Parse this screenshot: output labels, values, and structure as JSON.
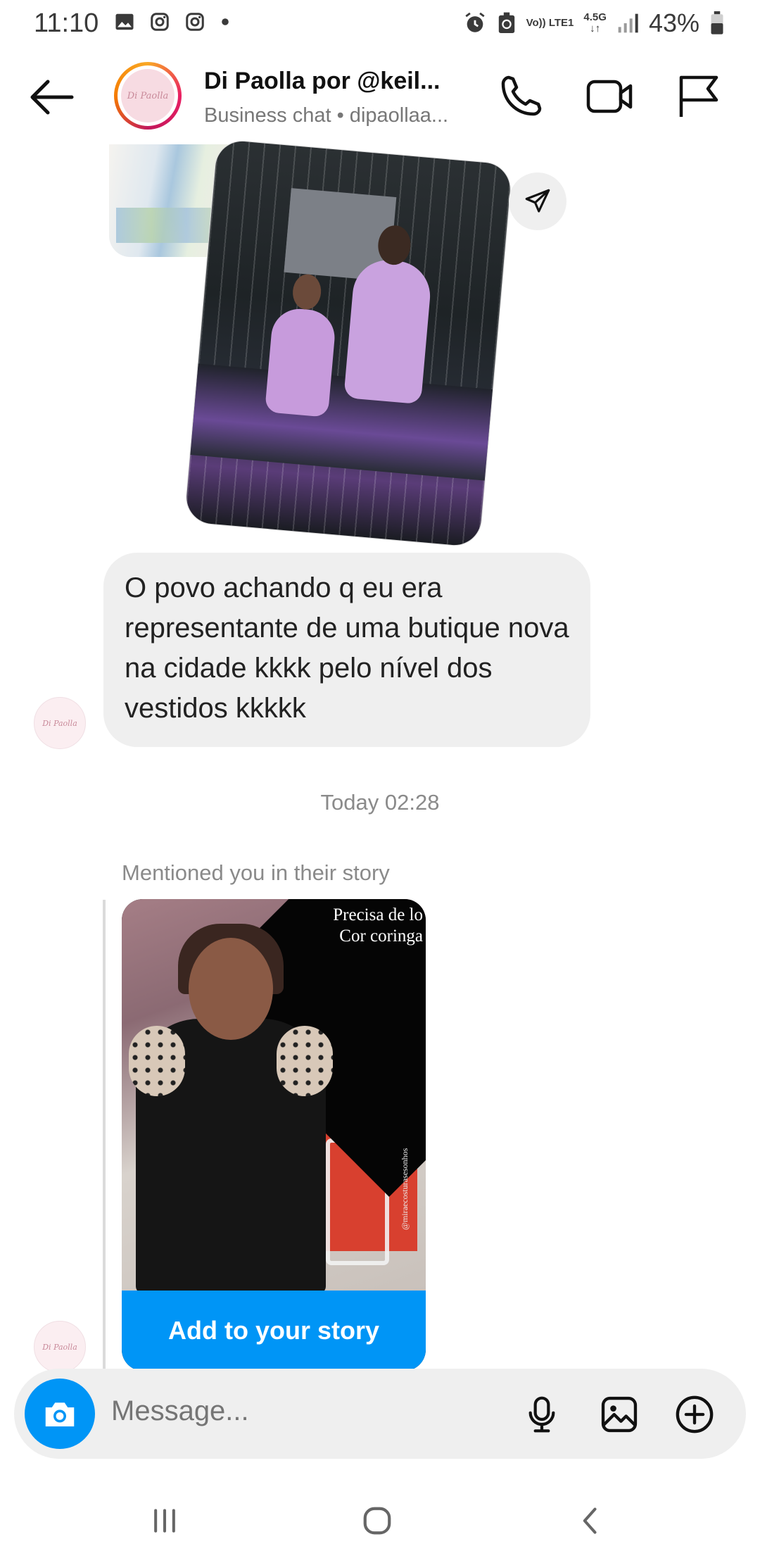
{
  "status_bar": {
    "time": "11:10",
    "network_label_top": "Vo)) LTE1",
    "network_type": "4.5G",
    "battery": "43%",
    "left_icons": [
      "gallery-icon",
      "instagram-icon",
      "instagram-icon",
      "dot-icon"
    ],
    "right_icons": [
      "alarm-icon",
      "data-saver-icon",
      "signal-icon",
      "battery-icon"
    ]
  },
  "header": {
    "title": "Di Paolla por @keil...",
    "subtitle": "Business chat • dipaollaa...",
    "avatar_text": "Di Paolla",
    "actions": [
      "phone-icon",
      "video-icon",
      "flag-icon"
    ]
  },
  "chat": {
    "message_text": "O povo achando q eu era representante de uma butique nova na cidade kkkk pelo nível dos vestidos kkkkk",
    "avatar_text": "Di Paolla",
    "timestamp": "Today 02:28",
    "mention_label": "Mentioned you in their story",
    "story": {
      "overlay_line1": "Precisa de lo",
      "overlay_line2": "Cor coringa",
      "watermark": "@miraecosturasesonhos",
      "button_label": "Add to your story"
    }
  },
  "composer": {
    "placeholder": "Message...",
    "icons": [
      "camera-icon",
      "microphone-icon",
      "gallery-icon",
      "add-circle-icon"
    ]
  },
  "colors": {
    "accent": "#0095f6",
    "bubble": "#efefef",
    "muted_text": "#8a8a8a"
  }
}
